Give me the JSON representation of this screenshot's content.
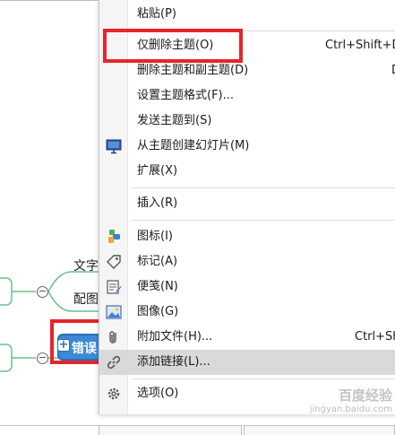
{
  "mindmap": {
    "node_text": "文字",
    "node_peitu": "配图",
    "node_error": "错误",
    "expand_symbol": "+",
    "collapse_symbol": "−"
  },
  "menu": {
    "items": [
      {
        "label": "粘贴(P)",
        "shortcut": "",
        "icon": ""
      },
      {
        "label": "仅删除主题(O)",
        "shortcut": "Ctrl+Shift+D",
        "icon": ""
      },
      {
        "label": "删除主题和副主题(D)",
        "shortcut": "D",
        "icon": ""
      },
      {
        "label": "设置主题格式(F)...",
        "shortcut": "",
        "icon": ""
      },
      {
        "label": "发送主题到(S)",
        "shortcut": "",
        "icon": ""
      },
      {
        "label": "从主题创建幻灯片(M)",
        "shortcut": "",
        "icon": "slide-icon"
      },
      {
        "label": "扩展(X)",
        "shortcut": "",
        "icon": ""
      },
      {
        "label": "插入(R)",
        "shortcut": "",
        "icon": ""
      },
      {
        "label": "图标(I)",
        "shortcut": "",
        "icon": "puzzle-icon"
      },
      {
        "label": "标记(A)",
        "shortcut": "",
        "icon": "tag-icon"
      },
      {
        "label": "便笺(N)",
        "shortcut": "",
        "icon": "note-icon"
      },
      {
        "label": "图像(G)",
        "shortcut": "",
        "icon": "image-icon"
      },
      {
        "label": "附加文件(H)...",
        "shortcut": "Ctrl+Sh",
        "icon": "paperclip-icon"
      },
      {
        "label": "添加链接(L)...",
        "shortcut": "",
        "icon": "link-icon"
      },
      {
        "label": "选项(O)",
        "shortcut": "",
        "icon": "gear-icon"
      }
    ],
    "hovered_item": "添加链接(L)..."
  },
  "colors": {
    "highlight_box": "#e8252a",
    "topic_blue": "#3d89d6",
    "node_green": "#6dbf8a"
  },
  "watermark": {
    "line1": "百度经验",
    "line2": "jingyan.baidu.com"
  }
}
